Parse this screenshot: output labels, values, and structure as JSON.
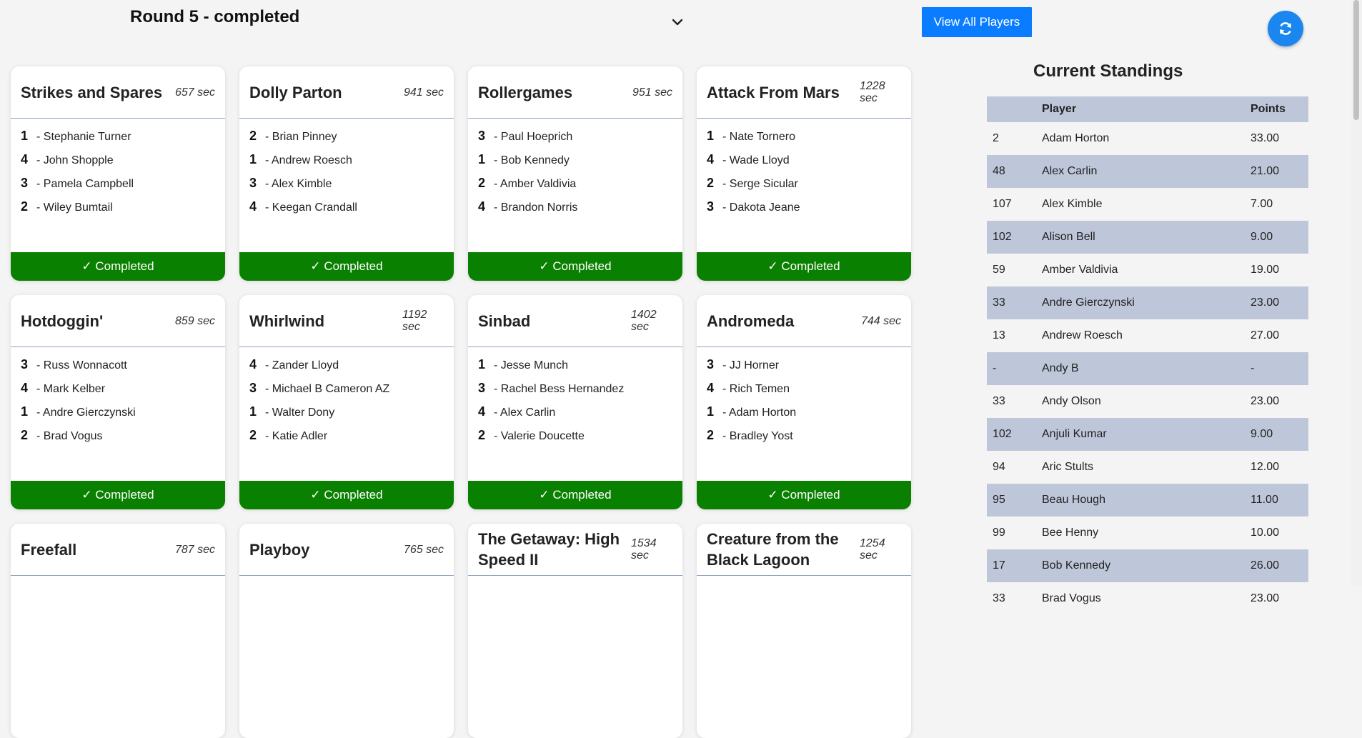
{
  "header": {
    "round_title": "Round 5 - completed",
    "view_all_label": "View All Players"
  },
  "colors": {
    "accent": "#0a7cff",
    "completed": "#0a8000",
    "table_stripe": "#bec7da"
  },
  "cards": [
    {
      "name": "Strikes and Spares",
      "time": "657 sec",
      "status": "✓ Completed",
      "players": [
        {
          "pos": "1",
          "name": "- Stephanie Turner"
        },
        {
          "pos": "4",
          "name": "- John Shopple"
        },
        {
          "pos": "3",
          "name": "- Pamela Campbell"
        },
        {
          "pos": "2",
          "name": "- Wiley Bumtail"
        }
      ]
    },
    {
      "name": "Dolly Parton",
      "time": "941 sec",
      "status": "✓ Completed",
      "players": [
        {
          "pos": "2",
          "name": "- Brian Pinney"
        },
        {
          "pos": "1",
          "name": "- Andrew Roesch"
        },
        {
          "pos": "3",
          "name": "- Alex Kimble"
        },
        {
          "pos": "4",
          "name": "- Keegan Crandall"
        }
      ]
    },
    {
      "name": "Rollergames",
      "time": "951 sec",
      "status": "✓ Completed",
      "players": [
        {
          "pos": "3",
          "name": "- Paul Hoeprich"
        },
        {
          "pos": "1",
          "name": "- Bob Kennedy"
        },
        {
          "pos": "2",
          "name": "- Amber Valdivia"
        },
        {
          "pos": "4",
          "name": "- Brandon Norris"
        }
      ]
    },
    {
      "name": "Attack From Mars",
      "time": "1228 sec",
      "status": "✓ Completed",
      "players": [
        {
          "pos": "1",
          "name": "- Nate Tornero"
        },
        {
          "pos": "4",
          "name": "- Wade Lloyd"
        },
        {
          "pos": "2",
          "name": "- Serge Sicular"
        },
        {
          "pos": "3",
          "name": "- Dakota Jeane"
        }
      ]
    },
    {
      "name": "Hotdoggin'",
      "time": "859 sec",
      "status": "✓ Completed",
      "players": [
        {
          "pos": "3",
          "name": "- Russ Wonnacott"
        },
        {
          "pos": "4",
          "name": "- Mark Kelber"
        },
        {
          "pos": "1",
          "name": "- Andre Gierczynski"
        },
        {
          "pos": "2",
          "name": "- Brad Vogus"
        }
      ]
    },
    {
      "name": "Whirlwind",
      "time": "1192 sec",
      "status": "✓ Completed",
      "players": [
        {
          "pos": "4",
          "name": "- Zander Lloyd"
        },
        {
          "pos": "3",
          "name": "- Michael B Cameron AZ"
        },
        {
          "pos": "1",
          "name": "- Walter Dony"
        },
        {
          "pos": "2",
          "name": "- Katie Adler"
        }
      ]
    },
    {
      "name": "Sinbad",
      "time": "1402 sec",
      "status": "✓ Completed",
      "players": [
        {
          "pos": "1",
          "name": "- Jesse Munch"
        },
        {
          "pos": "3",
          "name": "- Rachel Bess Hernandez"
        },
        {
          "pos": "4",
          "name": "- Alex Carlin"
        },
        {
          "pos": "2",
          "name": "- Valerie Doucette"
        }
      ]
    },
    {
      "name": "Andromeda",
      "time": "744 sec",
      "status": "✓ Completed",
      "players": [
        {
          "pos": "3",
          "name": "- JJ Horner"
        },
        {
          "pos": "4",
          "name": "- Rich Temen"
        },
        {
          "pos": "1",
          "name": "- Adam Horton"
        },
        {
          "pos": "2",
          "name": "- Bradley Yost"
        }
      ]
    },
    {
      "name": "Freefall",
      "time": "787 sec",
      "status": "",
      "players": []
    },
    {
      "name": "Playboy",
      "time": "765 sec",
      "status": "",
      "players": []
    },
    {
      "name": "The Getaway: High Speed II",
      "time": "1534 sec",
      "status": "",
      "players": []
    },
    {
      "name": "Creature from the Black Lagoon",
      "time": "1254 sec",
      "status": "",
      "players": []
    }
  ],
  "standings": {
    "title": "Current Standings",
    "headers": [
      "",
      "Player",
      "Points"
    ],
    "rows": [
      [
        "2",
        "Adam Horton",
        "33.00"
      ],
      [
        "48",
        "Alex Carlin",
        "21.00"
      ],
      [
        "107",
        "Alex Kimble",
        "7.00"
      ],
      [
        "102",
        "Alison Bell",
        "9.00"
      ],
      [
        "59",
        "Amber Valdivia",
        "19.00"
      ],
      [
        "33",
        "Andre Gierczynski",
        "23.00"
      ],
      [
        "13",
        "Andrew Roesch",
        "27.00"
      ],
      [
        "-",
        "Andy B",
        "-"
      ],
      [
        "33",
        "Andy Olson",
        "23.00"
      ],
      [
        "102",
        "Anjuli Kumar",
        "9.00"
      ],
      [
        "94",
        "Aric Stults",
        "12.00"
      ],
      [
        "95",
        "Beau Hough",
        "11.00"
      ],
      [
        "99",
        "Bee Henny",
        "10.00"
      ],
      [
        "17",
        "Bob Kennedy",
        "26.00"
      ],
      [
        "33",
        "Brad Vogus",
        "23.00"
      ]
    ]
  }
}
